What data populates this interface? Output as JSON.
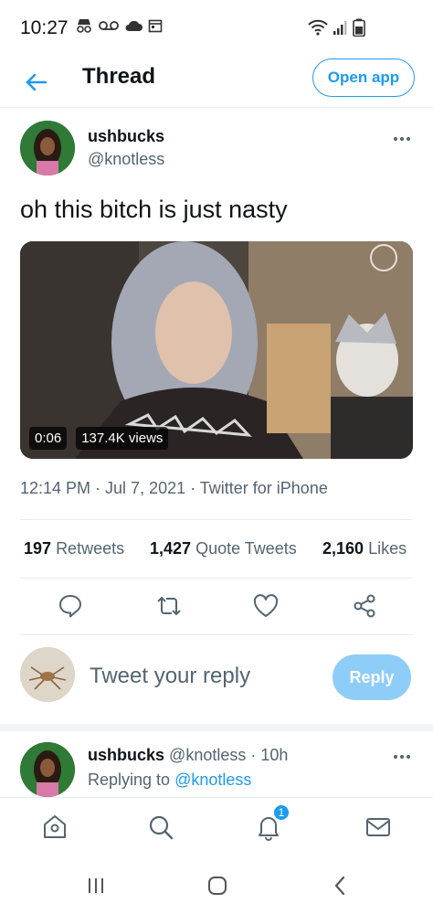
{
  "status_bar": {
    "time": "10:27",
    "left_icons": [
      "incognito-icon",
      "voicemail-icon",
      "cloud-icon",
      "calendar-icon"
    ],
    "right_icons": [
      "wifi-icon",
      "signal-icon",
      "battery-icon"
    ]
  },
  "header": {
    "title": "Thread",
    "open_app_label": "Open app"
  },
  "tweet": {
    "author_name": "ushbucks",
    "author_handle": "@knotless",
    "text": "oh this bitch is just nasty",
    "media": {
      "duration": "0:06",
      "views": "137.4K views"
    },
    "timestamp": "12:14 PM · Jul 7, 2021 · Twitter for iPhone"
  },
  "stats": {
    "retweets_count": "197",
    "retweets_label": "Retweets",
    "quotes_count": "1,427",
    "quotes_label": "Quote Tweets",
    "likes_count": "2,160",
    "likes_label": "Likes"
  },
  "reply_composer": {
    "placeholder": "Tweet your reply",
    "button_label": "Reply"
  },
  "reply_tweet": {
    "author_name": "ushbucks",
    "author_handle": "@knotless",
    "time_ago": "· 10h",
    "replying_prefix": "Replying to",
    "replying_to": "@knotless"
  },
  "tab_bar": {
    "notification_count": "1"
  },
  "colors": {
    "accent": "#1d9bf0",
    "text_primary": "#0f1419",
    "text_secondary": "#536471"
  }
}
